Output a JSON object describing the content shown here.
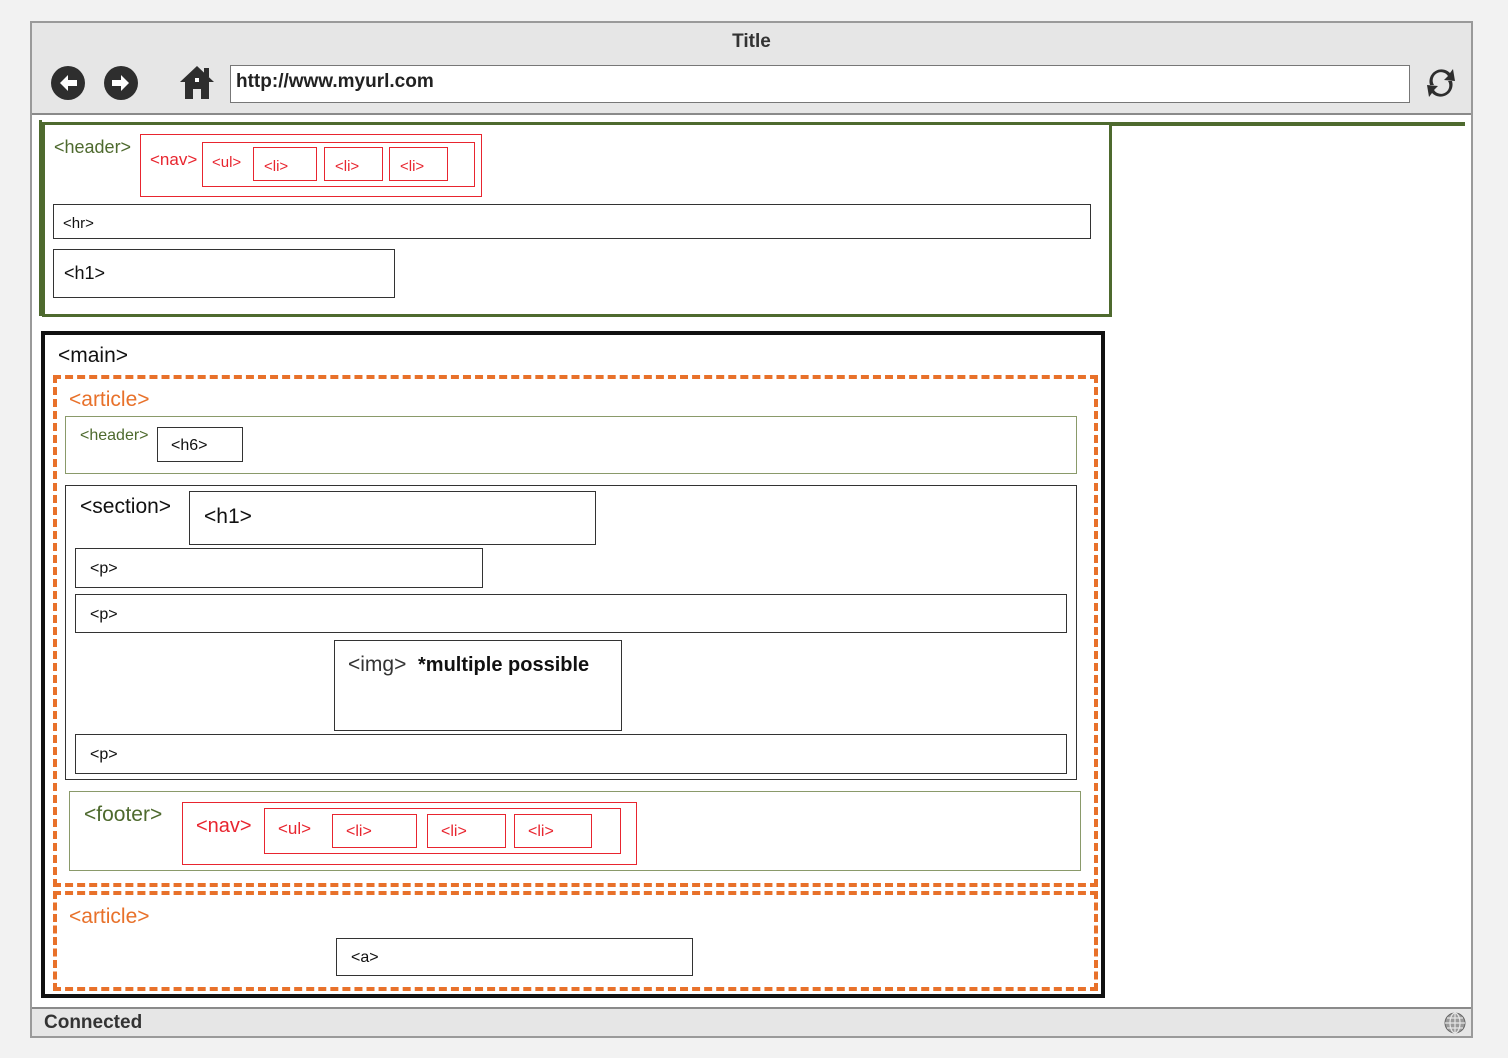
{
  "browser": {
    "title": "Title",
    "url": "http://www.myurl.com",
    "status": "Connected",
    "icons": [
      "back-arrow-icon",
      "forward-arrow-icon",
      "home-icon",
      "refresh-icon",
      "globe-icon"
    ]
  },
  "page_header": {
    "header_tag": "<header>",
    "nav_tag": "<nav>",
    "ul_tag": "<ul>",
    "li_tags": [
      "<li>",
      "<li>",
      "<li>"
    ],
    "hr_tag": "<hr>",
    "h1_tag": "<h1>"
  },
  "main": {
    "main_tag": "<main>",
    "article1": {
      "article_tag": "<article>",
      "header_tag": "<header>",
      "h6_tag": "<h6>",
      "section_tag": "<section>",
      "h1_tag": "<h1>",
      "p_tags": [
        "<p>",
        "<p>",
        "<p>"
      ],
      "img_tag": "<img>",
      "img_note": "*multiple possible",
      "footer_tag": "<footer>",
      "nav_tag": "<nav>",
      "ul_tag": "<ul>",
      "li_tags": [
        "<li>",
        "<li>",
        "<li>"
      ]
    },
    "article2": {
      "article_tag": "<article>",
      "a_tag": "<a>"
    }
  },
  "colors": {
    "header_green": "#4e6a2e",
    "nav_red": "#e8252f",
    "article_orange": "#e8712a",
    "main_black": "#111111"
  }
}
